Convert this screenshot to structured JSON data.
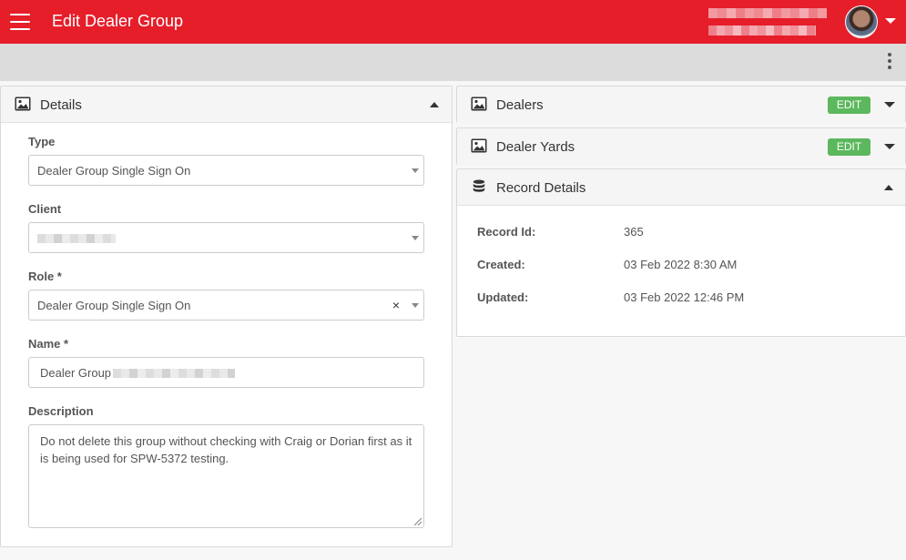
{
  "header": {
    "title": "Edit Dealer Group",
    "menu_icon": "hamburger-menu-icon",
    "user_menu_icon": "caret-down-icon"
  },
  "toolbar": {
    "more_icon": "kebab-vertical-icon"
  },
  "details": {
    "title": "Details",
    "icon": "image-icon",
    "fields": {
      "type": {
        "label": "Type",
        "value": "Dealer Group Single Sign On"
      },
      "client": {
        "label": "Client",
        "value": ""
      },
      "role": {
        "label": "Role *",
        "value": "Dealer Group Single Sign On",
        "clear": "×"
      },
      "name": {
        "label": "Name *",
        "value": "Dealer Group"
      },
      "description": {
        "label": "Description",
        "value": "Do not delete this group without checking with Craig or Dorian first as it is being used for SPW-5372 testing."
      }
    }
  },
  "dealers": {
    "title": "Dealers",
    "edit_label": "EDIT",
    "icon": "image-icon"
  },
  "dealer_yards": {
    "title": "Dealer Yards",
    "edit_label": "EDIT",
    "icon": "image-icon"
  },
  "record_details": {
    "title": "Record Details",
    "icon": "database-icon",
    "rows": [
      {
        "label": "Record Id:",
        "value": "365"
      },
      {
        "label": "Created:",
        "value": "03 Feb 2022 8:30 AM"
      },
      {
        "label": "Updated:",
        "value": "03 Feb 2022 12:46 PM"
      }
    ]
  },
  "colors": {
    "brand": "#e51e2a",
    "edit_button": "#5cb85c"
  }
}
